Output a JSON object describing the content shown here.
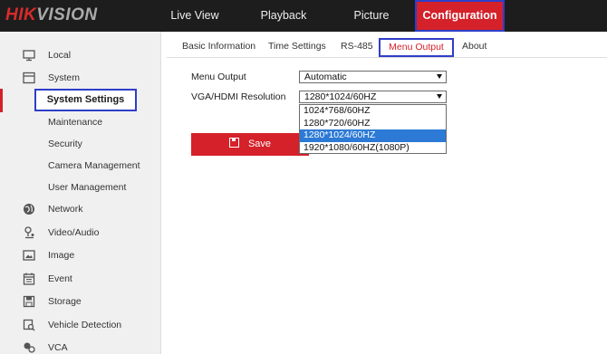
{
  "brand": {
    "logo_hi": "HIK",
    "logo_rest": "VISION"
  },
  "nav": [
    {
      "label": "Live View"
    },
    {
      "label": "Playback"
    },
    {
      "label": "Picture"
    },
    {
      "label": "Configuration",
      "active": true
    }
  ],
  "sidebar": {
    "items": [
      {
        "label": "Local",
        "icon": "monitor-icon"
      },
      {
        "label": "System",
        "icon": "system-icon"
      },
      {
        "label": "System Settings",
        "selected": true
      },
      {
        "label": "Maintenance"
      },
      {
        "label": "Security"
      },
      {
        "label": "Camera Management"
      },
      {
        "label": "User Management"
      },
      {
        "label": "Network",
        "icon": "globe-icon"
      },
      {
        "label": "Video/Audio",
        "icon": "video-audio-icon"
      },
      {
        "label": "Image",
        "icon": "image-icon"
      },
      {
        "label": "Event",
        "icon": "calendar-icon"
      },
      {
        "label": "Storage",
        "icon": "storage-icon"
      },
      {
        "label": "Vehicle Detection",
        "icon": "vehicle-detection-icon"
      },
      {
        "label": "VCA",
        "icon": "vca-icon"
      }
    ]
  },
  "tabs": [
    {
      "label": "Basic Information"
    },
    {
      "label": "Time Settings"
    },
    {
      "label": "RS-485"
    },
    {
      "label": "Menu Output",
      "active": true
    },
    {
      "label": "About"
    }
  ],
  "form": {
    "menu_output": {
      "label": "Menu Output",
      "value": "Automatic"
    },
    "resolution": {
      "label": "VGA/HDMI Resolution",
      "value": "1280*1024/60HZ",
      "options": [
        "1024*768/60HZ",
        "1280*720/60HZ",
        "1280*1024/60HZ",
        "1920*1080/60HZ(1080P)"
      ],
      "highlighted_option": "1280*1024/60HZ"
    },
    "save_label": "Save"
  },
  "colors": {
    "accent": "#d4212a",
    "highlight_border": "#2e3ec9",
    "selection": "#2c7ad6",
    "topbar": "#1d1d1d"
  }
}
